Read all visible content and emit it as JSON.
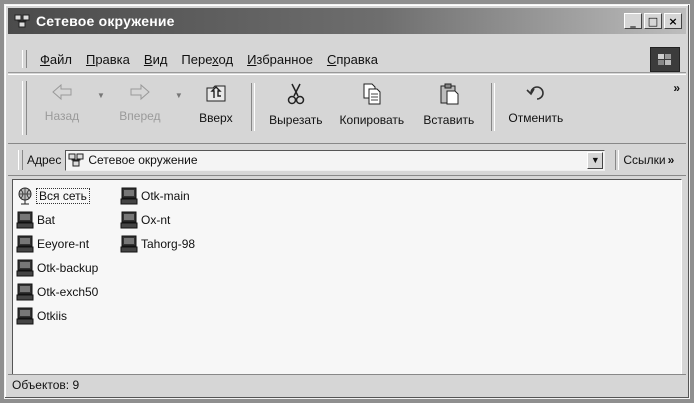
{
  "window": {
    "title": "Сетевое окружение",
    "buttons": {
      "minimize": "_",
      "maximize": "□",
      "close": "×"
    }
  },
  "menu": [
    {
      "accel": "Ф",
      "rest": "айл"
    },
    {
      "accel": "П",
      "rest": "равка"
    },
    {
      "accel": "В",
      "rest": "ид"
    },
    {
      "pre": "Пере",
      "accel": "х",
      "rest": "од"
    },
    {
      "accel": "И",
      "rest": "збранное"
    },
    {
      "accel": "С",
      "rest": "правка"
    }
  ],
  "toolbar": {
    "back": "Назад",
    "forward": "Вперед",
    "up": "Вверх",
    "cut": "Вырезать",
    "copy": "Копировать",
    "paste": "Вставить",
    "undo": "Отменить",
    "more": "»"
  },
  "address": {
    "label": "Адрес",
    "value": "Сетевое окружение",
    "links": "Ссылки",
    "links_more": "»"
  },
  "items": [
    {
      "label": "Вся сеть",
      "icon": "entire-network-icon"
    },
    {
      "label": "Bat",
      "icon": "computer-icon"
    },
    {
      "label": "Eeyore-nt",
      "icon": "computer-icon"
    },
    {
      "label": "Otk-backup",
      "icon": "computer-icon"
    },
    {
      "label": "Otk-exch50",
      "icon": "computer-icon"
    },
    {
      "label": "Otkiis",
      "icon": "computer-icon"
    },
    {
      "label": "Otk-main",
      "icon": "computer-icon"
    },
    {
      "label": "Ox-nt",
      "icon": "computer-icon"
    },
    {
      "label": "Tahorg-98",
      "icon": "computer-icon"
    }
  ],
  "status": {
    "text": "Объектов: 9"
  }
}
